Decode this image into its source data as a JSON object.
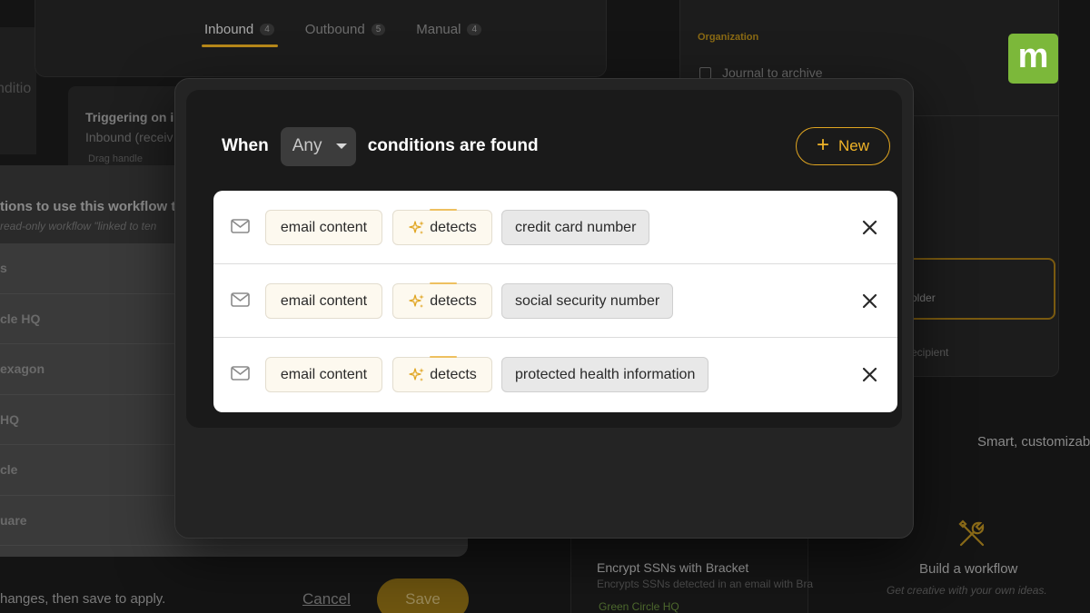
{
  "background": {
    "tabs": [
      {
        "label": "Inbound",
        "count": "4",
        "active": true
      },
      {
        "label": "Outbound",
        "count": "5",
        "active": false
      },
      {
        "label": "Manual",
        "count": "4",
        "active": false
      }
    ],
    "left_strip_text": "nditio",
    "trigger_title": "Triggering on i",
    "trigger_sub": "Inbound (receiv",
    "trigger_hint": "Drag handle",
    "left_panel": {
      "heading": "tions to use this workflow t",
      "subheading": "read-only workflow \"linked to ten",
      "rows": [
        "s",
        "cle HQ",
        "exagon",
        "HQ",
        "cle",
        "uare"
      ]
    },
    "footer_text": "hanges, then save to apply.",
    "cancel_label": "Cancel",
    "save_label": "Save",
    "right_panel": {
      "org_label": "Organization",
      "journal_label": "Journal to archive",
      "folder_text": "older",
      "recipient_text": "ecipient"
    },
    "smart_text": "Smart, customizab",
    "encrypt_card": {
      "title": "Encrypt SSNs with Bracket",
      "subtitle": "Encrypts SSNs detected in an email with Bra",
      "org": "Green Circle HQ"
    },
    "build_card": {
      "title": "Build a workflow",
      "subtitle": "Get creative with your own ideas."
    }
  },
  "logo_letter": "m",
  "modal": {
    "when_label": "When",
    "match_select": "Any",
    "suffix_label": "conditions are found",
    "new_button_label": "New",
    "conditions": [
      {
        "field": "email content",
        "operator": "detects",
        "value": "credit card number"
      },
      {
        "field": "email content",
        "operator": "detects",
        "value": "social security number"
      },
      {
        "field": "email content",
        "operator": "detects",
        "value": "protected health information"
      }
    ]
  },
  "colors": {
    "accent": "#e0a521",
    "logo": "#7cb83a",
    "modal_bg": "#242424",
    "conditions_bg": "#ffffff"
  }
}
